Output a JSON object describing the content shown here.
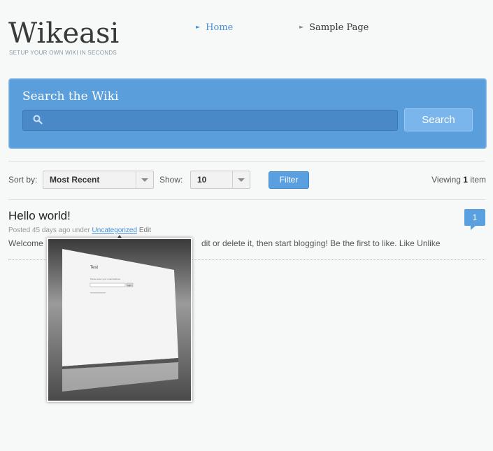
{
  "site": {
    "logo": "Wikeasi",
    "tagline": "SETUP YOUR OWN WIKI IN SECONDS"
  },
  "nav": {
    "items": [
      {
        "label": "Home"
      },
      {
        "label": "Sample Page"
      }
    ]
  },
  "search": {
    "title": "Search the Wiki",
    "button": "Search",
    "placeholder": ""
  },
  "filters": {
    "sort_label": "Sort by:",
    "sort_value": "Most Recent",
    "show_label": "Show:",
    "show_value": "10",
    "filter_button": "Filter",
    "viewing_prefix": "Viewing",
    "viewing_count": "1",
    "viewing_suffix": "item"
  },
  "post": {
    "title": "Hello world!",
    "meta_prefix": "Posted 45 days ago under",
    "category": "Uncategorized",
    "edit": "Edit",
    "body_start": "Welcome",
    "body_end": "dit or delete it, then start blogging! Be the first to like. Like Unlike",
    "comment_count": "1"
  },
  "preview": {
    "title": "Test",
    "prompt": "Please enter your email address",
    "button": "Login"
  },
  "colors": {
    "accent": "#4a90d9",
    "search_bg": "#5a9fdc"
  }
}
